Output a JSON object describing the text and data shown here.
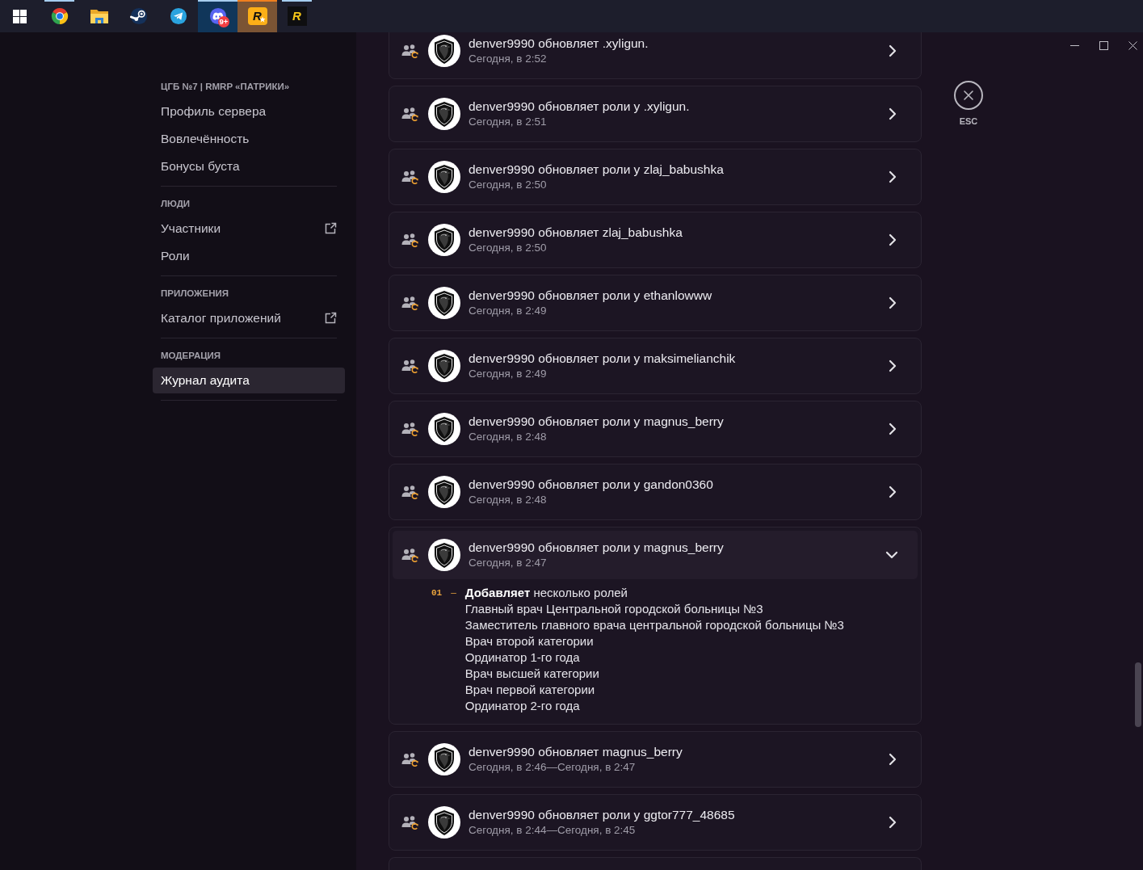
{
  "taskbar": {
    "apps": [
      {
        "kind": "browser",
        "running": true,
        "selected": false,
        "attention": false
      },
      {
        "kind": "files",
        "running": false,
        "selected": false,
        "attention": false
      },
      {
        "kind": "game-store",
        "running": false,
        "selected": false,
        "attention": false
      },
      {
        "kind": "messenger",
        "running": false,
        "selected": false,
        "attention": false
      },
      {
        "kind": "chat",
        "running": true,
        "selected": true,
        "attention": false,
        "badge": "9+"
      },
      {
        "kind": "launcher",
        "running": true,
        "selected": false,
        "attention": true,
        "glyph": "R"
      },
      {
        "kind": "game",
        "running": true,
        "selected": false,
        "attention": false,
        "glyph": "R"
      }
    ]
  },
  "sidebar": {
    "sections": [
      {
        "header": "ЦГБ №7 | RMRP «ПАТРИКИ»",
        "items": [
          {
            "label": "Профиль сервера",
            "selected": false,
            "external": false
          },
          {
            "label": "Вовлечённость",
            "selected": false,
            "external": false
          },
          {
            "label": "Бонусы буста",
            "selected": false,
            "external": false
          }
        ]
      },
      {
        "header": "ЛЮДИ",
        "items": [
          {
            "label": "Участники",
            "selected": false,
            "external": true
          },
          {
            "label": "Роли",
            "selected": false,
            "external": false
          }
        ]
      },
      {
        "header": "ПРИЛОЖЕНИЯ",
        "items": [
          {
            "label": "Каталог приложений",
            "selected": false,
            "external": true
          }
        ]
      },
      {
        "header": "МОДЕРАЦИЯ",
        "items": [
          {
            "label": "Журнал аудита",
            "selected": true,
            "external": false
          }
        ]
      }
    ]
  },
  "audit_log": {
    "entries": [
      {
        "title": "denver9990 обновляет .xyligun.",
        "time": "Сегодня, в 2:52",
        "expanded": false
      },
      {
        "title": "denver9990 обновляет роли у .xyligun.",
        "time": "Сегодня, в 2:51",
        "expanded": false
      },
      {
        "title": "denver9990 обновляет роли у zlaj_babushka",
        "time": "Сегодня, в 2:50",
        "expanded": false
      },
      {
        "title": "denver9990 обновляет zlaj_babushka",
        "time": "Сегодня, в 2:50",
        "expanded": false
      },
      {
        "title": "denver9990 обновляет роли у ethanlowww",
        "time": "Сегодня, в 2:49",
        "expanded": false
      },
      {
        "title": "denver9990 обновляет роли у maksimelianchik",
        "time": "Сегодня, в 2:49",
        "expanded": false
      },
      {
        "title": "denver9990 обновляет роли у magnus_berry",
        "time": "Сегодня, в 2:48",
        "expanded": false
      },
      {
        "title": "denver9990 обновляет роли у gandon0360",
        "time": "Сегодня, в 2:48",
        "expanded": false
      },
      {
        "title": "denver9990 обновляет роли у magnus_berry",
        "time": "Сегодня, в 2:47",
        "expanded": true,
        "changes": [
          {
            "number": "01",
            "dash": "—",
            "summary": "**Добавляет** несколько ролей",
            "roles": [
              "Главный врач Центральной городской больницы №3",
              "Заместитель главного врача центральной городской больницы №3",
              "Врач второй категории",
              "Ординатор 1-го года",
              "Врач высшей категории",
              "Врач первой категории",
              "Ординатор 2-го года"
            ]
          }
        ]
      },
      {
        "title": "denver9990 обновляет magnus_berry",
        "time": "Сегодня, в 2:46—Сегодня, в 2:47",
        "expanded": false
      },
      {
        "title": "denver9990 обновляет роли у ggtor777_48685",
        "time": "Сегодня, в 2:44—Сегодня, в 2:45",
        "expanded": false
      }
    ],
    "cut_off_entry": true
  },
  "close": {
    "hint": "ESC"
  }
}
